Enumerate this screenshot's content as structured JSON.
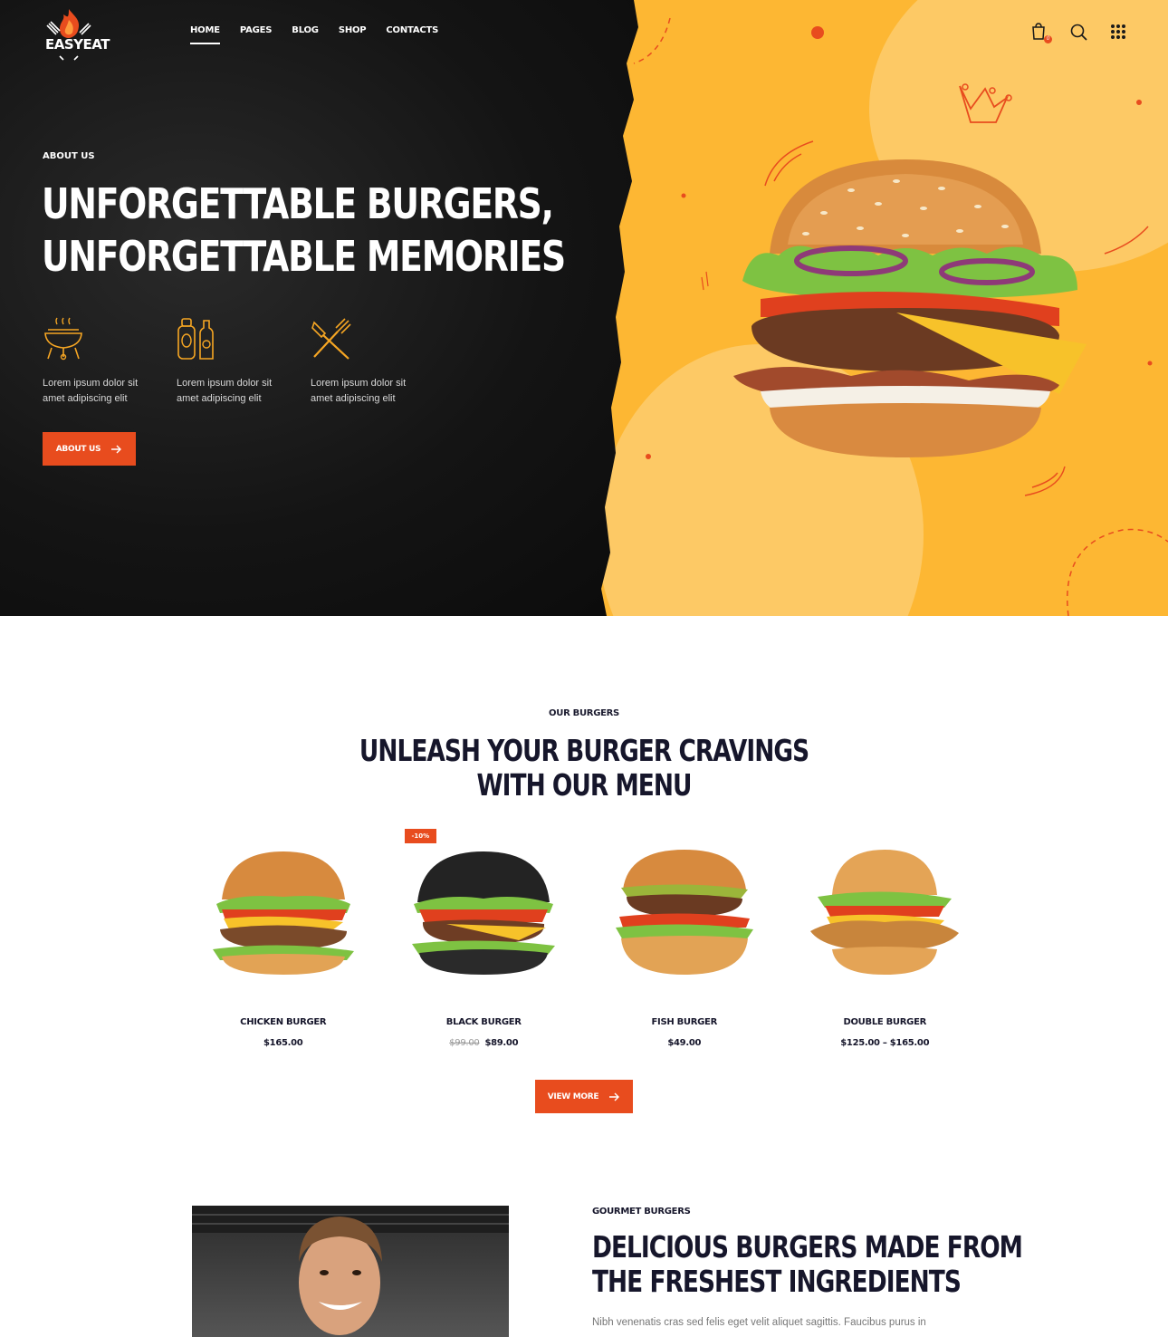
{
  "brand": {
    "name": "EASYEAT"
  },
  "nav": {
    "items": [
      "HOME",
      "PAGES",
      "BLOG",
      "SHOP",
      "CONTACTS"
    ]
  },
  "header_icons": {
    "cart": "cart-icon",
    "cart_count": "0",
    "search": "search-icon",
    "menu": "grid-menu-icon"
  },
  "hero": {
    "eyebrow": "ABOUT US",
    "title_line1": "UNFORGETTABLE BURGERS,",
    "title_line2": "UNFORGETTABLE MEMORIES",
    "features": [
      {
        "icon": "grill-icon",
        "text": "Lorem ipsum dolor sit amet adipiscing elit"
      },
      {
        "icon": "sauce-bottles-icon",
        "text": "Lorem ipsum dolor sit amet adipiscing elit"
      },
      {
        "icon": "spatula-fork-icon",
        "text": "Lorem ipsum dolor sit amet adipiscing elit"
      }
    ],
    "button": "ABOUT US"
  },
  "menu": {
    "eyebrow": "OUR BURGERS",
    "title_line1": "UNLEASH YOUR BURGER CRAVINGS",
    "title_line2": "WITH OUR MENU",
    "products": [
      {
        "name": "CHICKEN BURGER",
        "price": "$165.00",
        "old_price": "",
        "badge": ""
      },
      {
        "name": "BLACK BURGER",
        "price": "$89.00",
        "old_price": "$99.00",
        "badge": "-10%"
      },
      {
        "name": "FISH BURGER",
        "price": "$49.00",
        "old_price": "",
        "badge": ""
      },
      {
        "name": "DOUBLE BURGER",
        "price": "$125.00 – $165.00",
        "old_price": "",
        "badge": ""
      }
    ],
    "button": "VIEW MORE"
  },
  "gourmet": {
    "eyebrow": "GOURMET BURGERS",
    "title_line1": "DELICIOUS BURGERS MADE FROM",
    "title_line2": "THE FRESHEST INGREDIENTS",
    "text": "Nibh venenatis cras sed felis eget velit aliquet sagittis. Faucibus purus in"
  },
  "colors": {
    "accent": "#e84c1e",
    "yellow": "#fdb733",
    "yellow_light": "#fdc965",
    "dark": "#141414",
    "navy": "#16162b"
  }
}
